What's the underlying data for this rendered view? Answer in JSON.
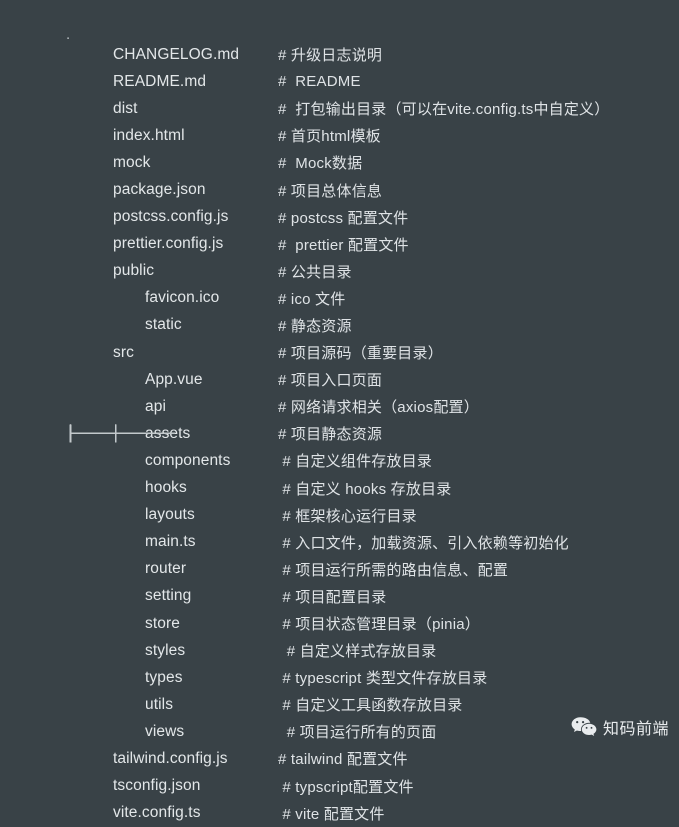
{
  "root_label": ".",
  "colors": {
    "background": "#394247",
    "tree_line": "#c3c9cc",
    "name_text": "#e3e7e9",
    "comment_text": "#dfe3e6"
  },
  "tree": {
    "rows": [
      {
        "depth": 0,
        "connector": "├──────",
        "name": "CHANGELOG.md",
        "comment": "# 升级日志说明"
      },
      {
        "depth": 0,
        "connector": "├──────",
        "name": "README.md",
        "comment": "#  README"
      },
      {
        "depth": 0,
        "connector": "├──────",
        "name": "dist",
        "comment": "#  打包输出目录（可以在vite.config.ts中自定义）"
      },
      {
        "depth": 0,
        "connector": "├──────",
        "name": "index.html",
        "comment": "# 首页html模板"
      },
      {
        "depth": 0,
        "connector": "├──────",
        "name": "mock",
        "comment": "#  Mock数据"
      },
      {
        "depth": 0,
        "connector": "├──────",
        "name": "package.json",
        "comment": "# 项目总体信息"
      },
      {
        "depth": 0,
        "connector": "├──────",
        "name": "postcss.config.js",
        "comment": "# postcss 配置文件"
      },
      {
        "depth": 0,
        "connector": "├──────",
        "name": "prettier.config.js",
        "comment": "#  prettier 配置文件"
      },
      {
        "depth": 0,
        "connector": "├──────",
        "name": "public",
        "comment": "# 公共目录"
      },
      {
        "depth": 1,
        "connector": "│    ├──────",
        "name": "favicon.ico",
        "comment": "# ico 文件"
      },
      {
        "depth": 1,
        "connector": "│    └──────",
        "name": "static",
        "comment": "# 静态资源"
      },
      {
        "depth": 0,
        "connector": "├──────",
        "name": "src",
        "comment": "# 项目源码（重要目录）"
      },
      {
        "depth": 1,
        "connector": "│    ├──────",
        "name": "App.vue",
        "comment": "# 项目入口页面"
      },
      {
        "depth": 1,
        "connector": "│    ├──────",
        "name": "api",
        "comment": "# 网络请求相关（axios配置）"
      },
      {
        "depth": 1,
        "connector": "│    ├──────",
        "name": "assets",
        "comment": "# 项目静态资源"
      },
      {
        "depth": 1,
        "connector": "│    ├──────",
        "name": "components",
        "comment": " # 自定义组件存放目录"
      },
      {
        "depth": 1,
        "connector": "│    ├──────",
        "name": "hooks",
        "comment": " # 自定义 hooks 存放目录"
      },
      {
        "depth": 1,
        "connector": "│    ├──────",
        "name": "layouts",
        "comment": " # 框架核心运行目录"
      },
      {
        "depth": 1,
        "connector": "│    ├──────",
        "name": "main.ts",
        "comment": " # 入口文件，加载资源、引入依赖等初始化"
      },
      {
        "depth": 1,
        "connector": "│    ├──────",
        "name": "router",
        "comment": " # 项目运行所需的路由信息、配置"
      },
      {
        "depth": 1,
        "connector": "│    ├──────",
        "name": "setting",
        "comment": " # 项目配置目录"
      },
      {
        "depth": 1,
        "connector": "│    ├──────",
        "name": "store",
        "comment": " # 项目状态管理目录（pinia）"
      },
      {
        "depth": 1,
        "connector": "│    ├──────",
        "name": "styles",
        "comment": "  # 自定义样式存放目录"
      },
      {
        "depth": 1,
        "connector": "│    ├──────",
        "name": "types",
        "comment": " # typescript 类型文件存放目录"
      },
      {
        "depth": 1,
        "connector": "│    ├──────",
        "name": "utils",
        "comment": " # 自定义工具函数存放目录"
      },
      {
        "depth": 1,
        "connector": "│    └──────",
        "name": "views",
        "comment": "  # 项目运行所有的页面"
      },
      {
        "depth": 0,
        "connector": "├──────",
        "name": "tailwind.config.js",
        "comment": "# tailwind 配置文件"
      },
      {
        "depth": 0,
        "connector": "├──────",
        "name": "tsconfig.json",
        "comment": " # typscript配置文件"
      },
      {
        "depth": 0,
        "connector": "├──────",
        "name": "vite.config.ts",
        "comment": " # vite 配置文件"
      }
    ]
  },
  "watermark": {
    "icon": "wechat-icon",
    "text": "知码前端"
  }
}
